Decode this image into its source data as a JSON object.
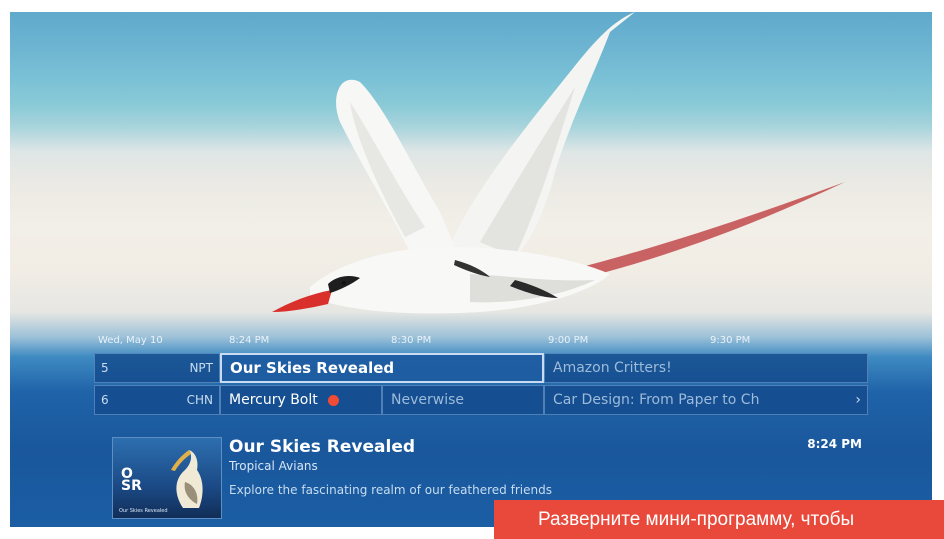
{
  "guide": {
    "date": "Wed, May 10",
    "times": [
      "8:24 PM",
      "8:30 PM",
      "9:00 PM",
      "9:30 PM"
    ],
    "rows": [
      {
        "number": "5",
        "callsign": "NPT",
        "programs": [
          "Our Skies Revealed",
          "Amazon Critters!"
        ]
      },
      {
        "number": "6",
        "callsign": "CHN",
        "programs": [
          "Mercury Bolt",
          "Neverwise",
          "Car Design: From Paper to Ch"
        ]
      }
    ],
    "next_icon": "chevron-right-icon",
    "record_icon": "record-dot-icon"
  },
  "details": {
    "title": "Our Skies Revealed",
    "subtitle": "Tropical Avians",
    "description": "Explore the fascinating realm of our feathered friends",
    "time": "8:24 PM",
    "poster_monogram_line1": "O",
    "poster_monogram_line2": "SR",
    "poster_caption": "Our Skies Revealed"
  },
  "banner": {
    "text": "Разверните мини-программу, чтобы"
  },
  "colors": {
    "accent_record": "#ef4b35",
    "banner": "#e8493a",
    "guide_cell": "#144b8c"
  }
}
